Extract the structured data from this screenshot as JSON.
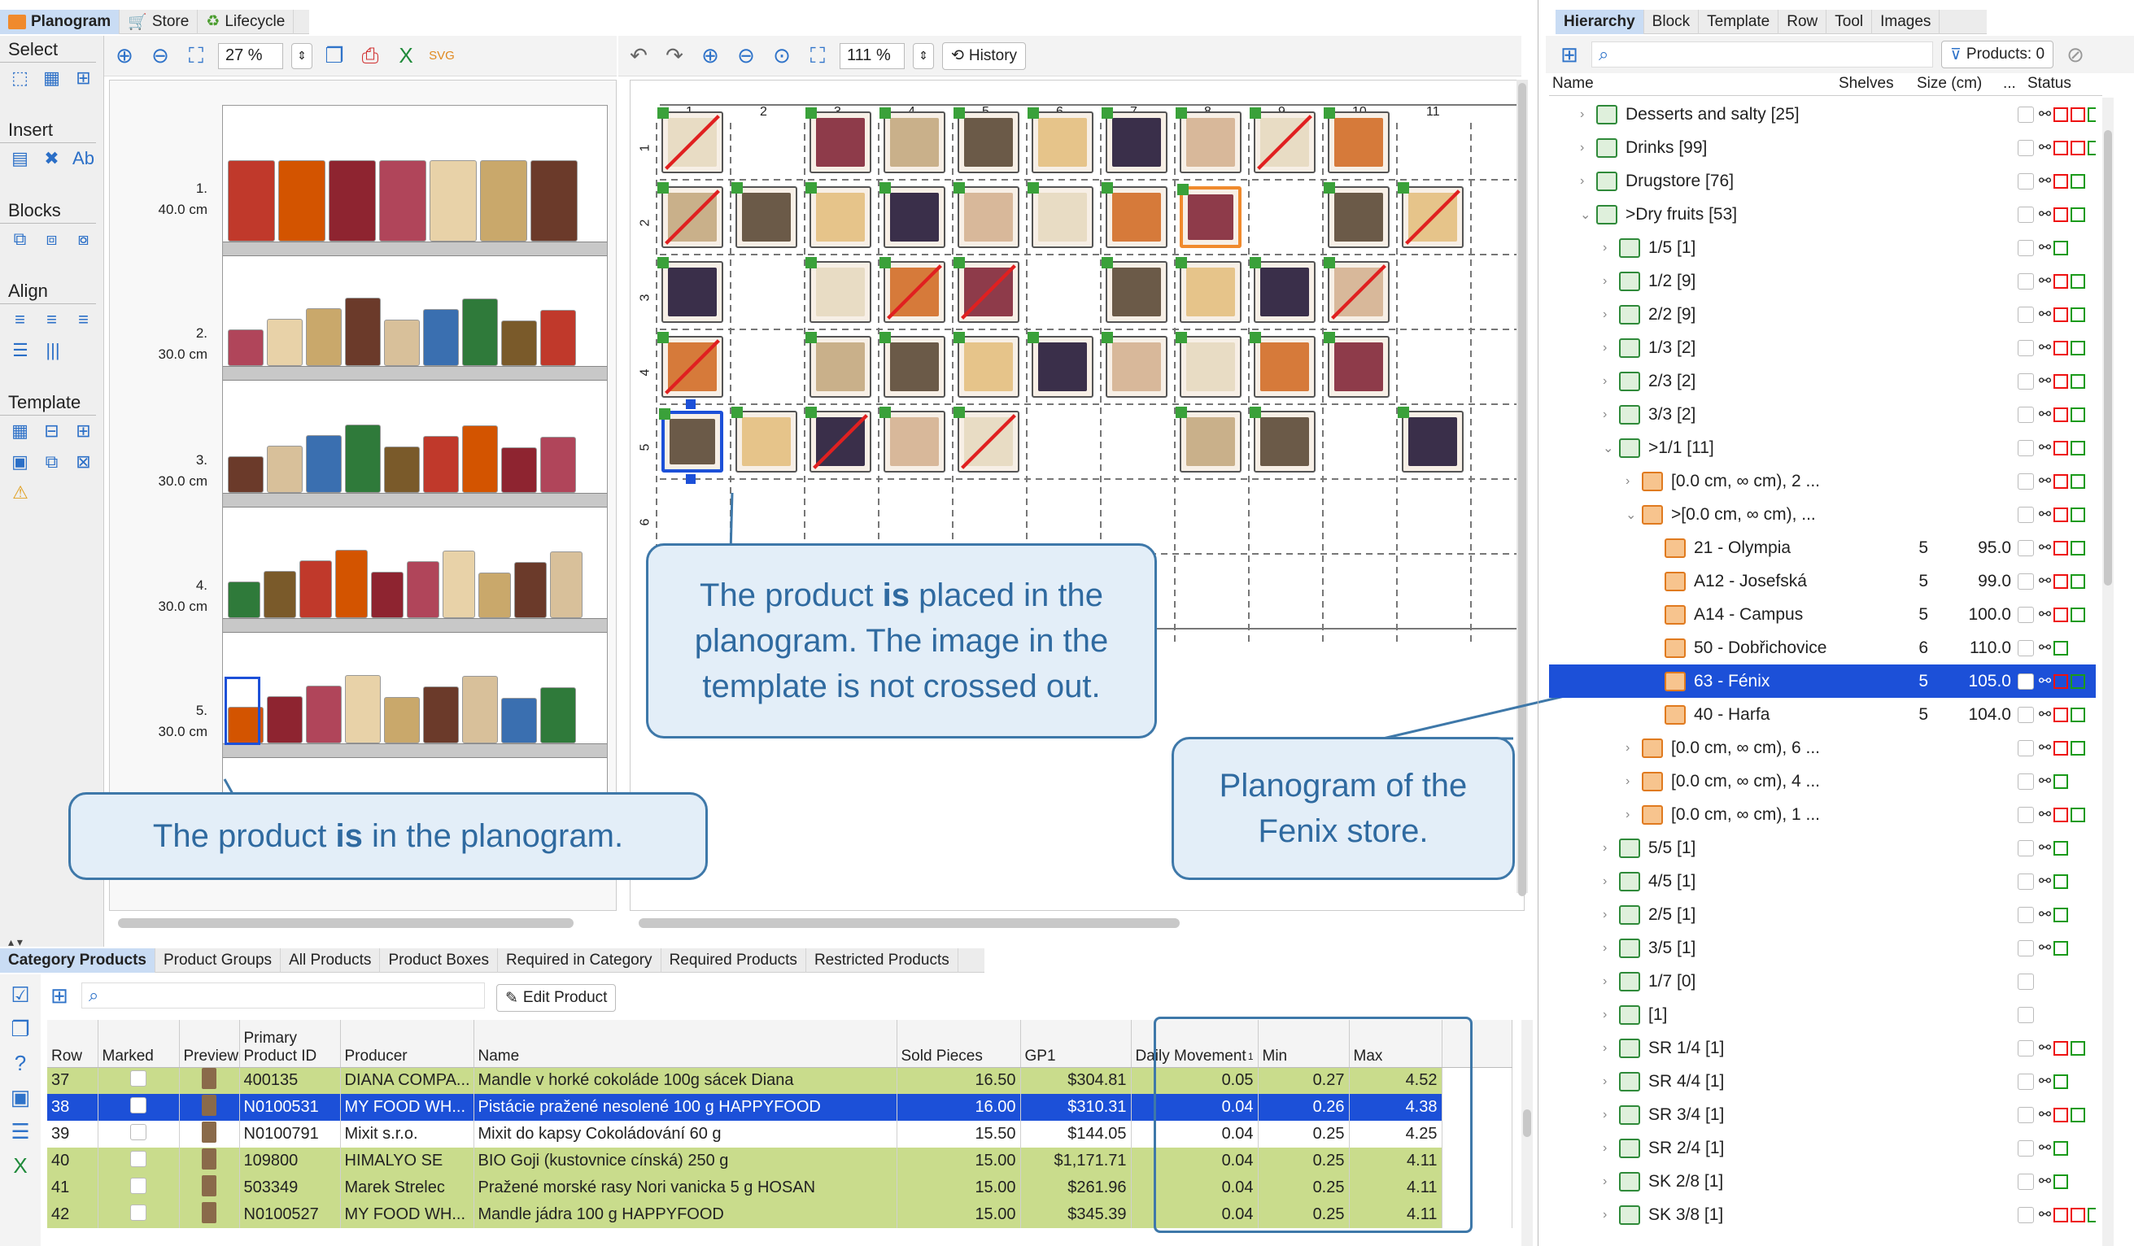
{
  "main_tabs": [
    {
      "label": "Planogram",
      "active": true
    },
    {
      "label": "Store",
      "active": false
    },
    {
      "label": "Lifecycle",
      "active": false
    }
  ],
  "left_tools": {
    "sections": [
      "Select",
      "Insert",
      "Blocks",
      "Align",
      "Template"
    ]
  },
  "planogram_toolbar": {
    "zoom": "27 %"
  },
  "template_toolbar": {
    "zoom": "111 %",
    "history_label": "History"
  },
  "shelves": [
    {
      "label": "1.",
      "height": "40.0 cm"
    },
    {
      "label": "2.",
      "height": "30.0 cm"
    },
    {
      "label": "3.",
      "height": "30.0 cm"
    },
    {
      "label": "4.",
      "height": "30.0 cm"
    },
    {
      "label": "5.",
      "height": "30.0 cm"
    }
  ],
  "grid": {
    "columns": [
      "1",
      "2",
      "3",
      "4",
      "5",
      "6",
      "7",
      "8",
      "9",
      "10",
      "11"
    ],
    "rows": [
      "1",
      "2",
      "3",
      "4",
      "5",
      "6"
    ]
  },
  "callouts": {
    "placed": {
      "pre": "The product ",
      "bold": "is",
      "post": " placed in the planogram. The image in the template is not crossed out."
    },
    "in_planogram": {
      "pre": "The product ",
      "bold": "is",
      "post": " in the planogram."
    },
    "fenix": {
      "text": "Planogram of the Fenix store."
    }
  },
  "right_tabs": [
    {
      "label": "Hierarchy",
      "active": true
    },
    {
      "label": "Block",
      "active": false
    },
    {
      "label": "Template",
      "active": false
    },
    {
      "label": "Row",
      "active": false
    },
    {
      "label": "Tool",
      "active": false
    },
    {
      "label": "Images",
      "active": false
    }
  ],
  "hierarchy": {
    "products_badge": "Products: 0",
    "columns": {
      "name": "Name",
      "shelves": "Shelves",
      "size": "Size (cm)",
      "more": "...",
      "status": "Status"
    },
    "rows": [
      {
        "label": "Desserts and salty [25]",
        "indent": 1,
        "icon": "g",
        "shelves": "",
        "size": "",
        "status": "link,red,red,green",
        "chev": ">"
      },
      {
        "label": "Drinks [99]",
        "indent": 1,
        "icon": "g",
        "shelves": "",
        "size": "",
        "status": "link,red,red,green",
        "chev": ">"
      },
      {
        "label": "Drugstore [76]",
        "indent": 1,
        "icon": "g",
        "shelves": "",
        "size": "",
        "status": "link,red,green",
        "chev": ">"
      },
      {
        "label": ">Dry fruits [53]",
        "indent": 1,
        "icon": "g",
        "shelves": "",
        "size": "",
        "status": "link,red,green",
        "chev": "v"
      },
      {
        "label": "1/5 [1]",
        "indent": 2,
        "icon": "g",
        "shelves": "",
        "size": "",
        "status": "link,green",
        "chev": ">"
      },
      {
        "label": "1/2 [9]",
        "indent": 2,
        "icon": "g",
        "shelves": "",
        "size": "",
        "status": "link,red,green",
        "chev": ">"
      },
      {
        "label": "2/2 [9]",
        "indent": 2,
        "icon": "g",
        "shelves": "",
        "size": "",
        "status": "link,red,green",
        "chev": ">"
      },
      {
        "label": "1/3 [2]",
        "indent": 2,
        "icon": "g",
        "shelves": "",
        "size": "",
        "status": "link,red,green",
        "chev": ">"
      },
      {
        "label": "2/3 [2]",
        "indent": 2,
        "icon": "g",
        "shelves": "",
        "size": "",
        "status": "link,red,green",
        "chev": ">"
      },
      {
        "label": "3/3 [2]",
        "indent": 2,
        "icon": "g",
        "shelves": "",
        "size": "",
        "status": "link,red,green",
        "chev": ">"
      },
      {
        "label": ">1/1 [11]",
        "indent": 2,
        "icon": "g",
        "shelves": "",
        "size": "",
        "status": "link,red,green",
        "chev": "v"
      },
      {
        "label": "[0.0 cm, ∞ cm), 2 ...",
        "indent": 3,
        "icon": "o",
        "shelves": "",
        "size": "",
        "status": "link,red,green",
        "chev": ">"
      },
      {
        "label": ">[0.0 cm, ∞ cm), ...",
        "indent": 3,
        "icon": "o",
        "shelves": "",
        "size": "",
        "status": "link,red,green",
        "chev": "v"
      },
      {
        "label": "21 - Olympia",
        "indent": 4,
        "icon": "o",
        "shelves": "5",
        "size": "95.0",
        "status": "link,red,green",
        "chev": ""
      },
      {
        "label": "A12 - Josefská",
        "indent": 4,
        "icon": "o",
        "shelves": "5",
        "size": "99.0",
        "status": "link,red,green",
        "chev": ""
      },
      {
        "label": "A14 - Campus",
        "indent": 4,
        "icon": "o",
        "shelves": "5",
        "size": "100.0",
        "status": "link,red,green",
        "chev": ""
      },
      {
        "label": "50 - Dobřichovice",
        "indent": 4,
        "icon": "o",
        "shelves": "6",
        "size": "110.0",
        "status": "link,green",
        "chev": ""
      },
      {
        "label": "63 - Fénix",
        "indent": 4,
        "icon": "o",
        "shelves": "5",
        "size": "105.0",
        "status": "link,red,green",
        "chev": "",
        "selected": true
      },
      {
        "label": "40 - Harfa",
        "indent": 4,
        "icon": "o",
        "shelves": "5",
        "size": "104.0",
        "status": "link,red,green",
        "chev": ""
      },
      {
        "label": "[0.0 cm, ∞ cm), 6 ...",
        "indent": 3,
        "icon": "o",
        "shelves": "",
        "size": "",
        "status": "link,red,green",
        "chev": ">"
      },
      {
        "label": "[0.0 cm, ∞ cm), 4 ...",
        "indent": 3,
        "icon": "o",
        "shelves": "",
        "size": "",
        "status": "link,green",
        "chev": ">"
      },
      {
        "label": "[0.0 cm, ∞ cm), 1 ...",
        "indent": 3,
        "icon": "o",
        "shelves": "",
        "size": "",
        "status": "link,red,green",
        "chev": ">"
      },
      {
        "label": "5/5 [1]",
        "indent": 2,
        "icon": "g",
        "shelves": "",
        "size": "",
        "status": "link,green",
        "chev": ">"
      },
      {
        "label": "4/5 [1]",
        "indent": 2,
        "icon": "g",
        "shelves": "",
        "size": "",
        "status": "link,green",
        "chev": ">"
      },
      {
        "label": "2/5 [1]",
        "indent": 2,
        "icon": "g",
        "shelves": "",
        "size": "",
        "status": "link,green",
        "chev": ">"
      },
      {
        "label": "3/5 [1]",
        "indent": 2,
        "icon": "g",
        "shelves": "",
        "size": "",
        "status": "link,green",
        "chev": ">"
      },
      {
        "label": "1/7 [0]",
        "indent": 2,
        "icon": "g",
        "shelves": "",
        "size": "",
        "status": "",
        "chev": ">"
      },
      {
        "label": " [1]",
        "indent": 2,
        "icon": "g",
        "shelves": "",
        "size": "",
        "status": "",
        "chev": ">"
      },
      {
        "label": "SR 1/4 [1]",
        "indent": 2,
        "icon": "g",
        "shelves": "",
        "size": "",
        "status": "link,red,green",
        "chev": ">"
      },
      {
        "label": "SR 4/4 [1]",
        "indent": 2,
        "icon": "g",
        "shelves": "",
        "size": "",
        "status": "link,green",
        "chev": ">"
      },
      {
        "label": "SR 3/4 [1]",
        "indent": 2,
        "icon": "g",
        "shelves": "",
        "size": "",
        "status": "link,red,green",
        "chev": ">"
      },
      {
        "label": "SR 2/4 [1]",
        "indent": 2,
        "icon": "g",
        "shelves": "",
        "size": "",
        "status": "link,green",
        "chev": ">"
      },
      {
        "label": "SK 2/8 [1]",
        "indent": 2,
        "icon": "g",
        "shelves": "",
        "size": "",
        "status": "link,green",
        "chev": ">"
      },
      {
        "label": "SK 3/8 [1]",
        "indent": 2,
        "icon": "g",
        "shelves": "",
        "size": "",
        "status": "link,red,red,green",
        "chev": ">"
      }
    ]
  },
  "bottom_tabs": [
    {
      "label": "Category Products",
      "active": true
    },
    {
      "label": "Product Groups",
      "active": false
    },
    {
      "label": "All Products",
      "active": false
    },
    {
      "label": "Product Boxes",
      "active": false
    },
    {
      "label": "Required in Category",
      "active": false
    },
    {
      "label": "Required Products",
      "active": false
    },
    {
      "label": "Restricted Products",
      "active": false
    }
  ],
  "edit_product_label": "Edit Product",
  "table": {
    "headers": [
      "Row",
      "Marked",
      "Preview",
      "Primary Product ID",
      "Producer",
      "Name",
      "Sold Pieces",
      "GP1",
      "Daily Movement",
      "Min",
      "Max"
    ],
    "sort_indicator": "1",
    "rows": [
      {
        "row": "37",
        "id": "400135",
        "producer": "DIANA COMPA...",
        "name": "Mandle v horké cokoláde 100g sácek Diana",
        "sold": "16.50",
        "gp1": "$304.81",
        "daily": "0.05",
        "min": "0.27",
        "max": "4.52",
        "style": "hl"
      },
      {
        "row": "38",
        "id": "N0100531",
        "producer": "MY FOOD WH...",
        "name": "Pistácie pražené nesolené 100 g HAPPYFOOD",
        "sold": "16.00",
        "gp1": "$310.31",
        "daily": "0.04",
        "min": "0.26",
        "max": "4.38",
        "style": "sel"
      },
      {
        "row": "39",
        "id": "N0100791",
        "producer": "Mixit s.r.o.",
        "name": "Mixit do kapsy Cokoládování 60 g",
        "sold": "15.50",
        "gp1": "$144.05",
        "daily": "0.04",
        "min": "0.25",
        "max": "4.25",
        "style": ""
      },
      {
        "row": "40",
        "id": "109800",
        "producer": "HIMALYO SE",
        "name": "BIO Goji (kustovnice cínská) 250 g",
        "sold": "15.00",
        "gp1": "$1,171.71",
        "daily": "0.04",
        "min": "0.25",
        "max": "4.11",
        "style": "hl"
      },
      {
        "row": "41",
        "id": "503349",
        "producer": "Marek Strelec",
        "name": "Pražené morské rasy Nori vanicka 5 g HOSAN",
        "sold": "15.00",
        "gp1": "$261.96",
        "daily": "0.04",
        "min": "0.25",
        "max": "4.11",
        "style": "hl"
      },
      {
        "row": "42",
        "id": "N0100527",
        "producer": "MY FOOD WH...",
        "name": "Mandle jádra 100 g HAPPYFOOD",
        "sold": "15.00",
        "gp1": "$345.39",
        "daily": "0.04",
        "min": "0.25",
        "max": "4.11",
        "style": "hl"
      }
    ]
  },
  "colors": {
    "selection": "#1c50d8",
    "highlight": "#c9dc8c",
    "callout_border": "#3e78a9",
    "callout_bg": "#e3eef8",
    "placed_marker": "#3aa13a"
  }
}
